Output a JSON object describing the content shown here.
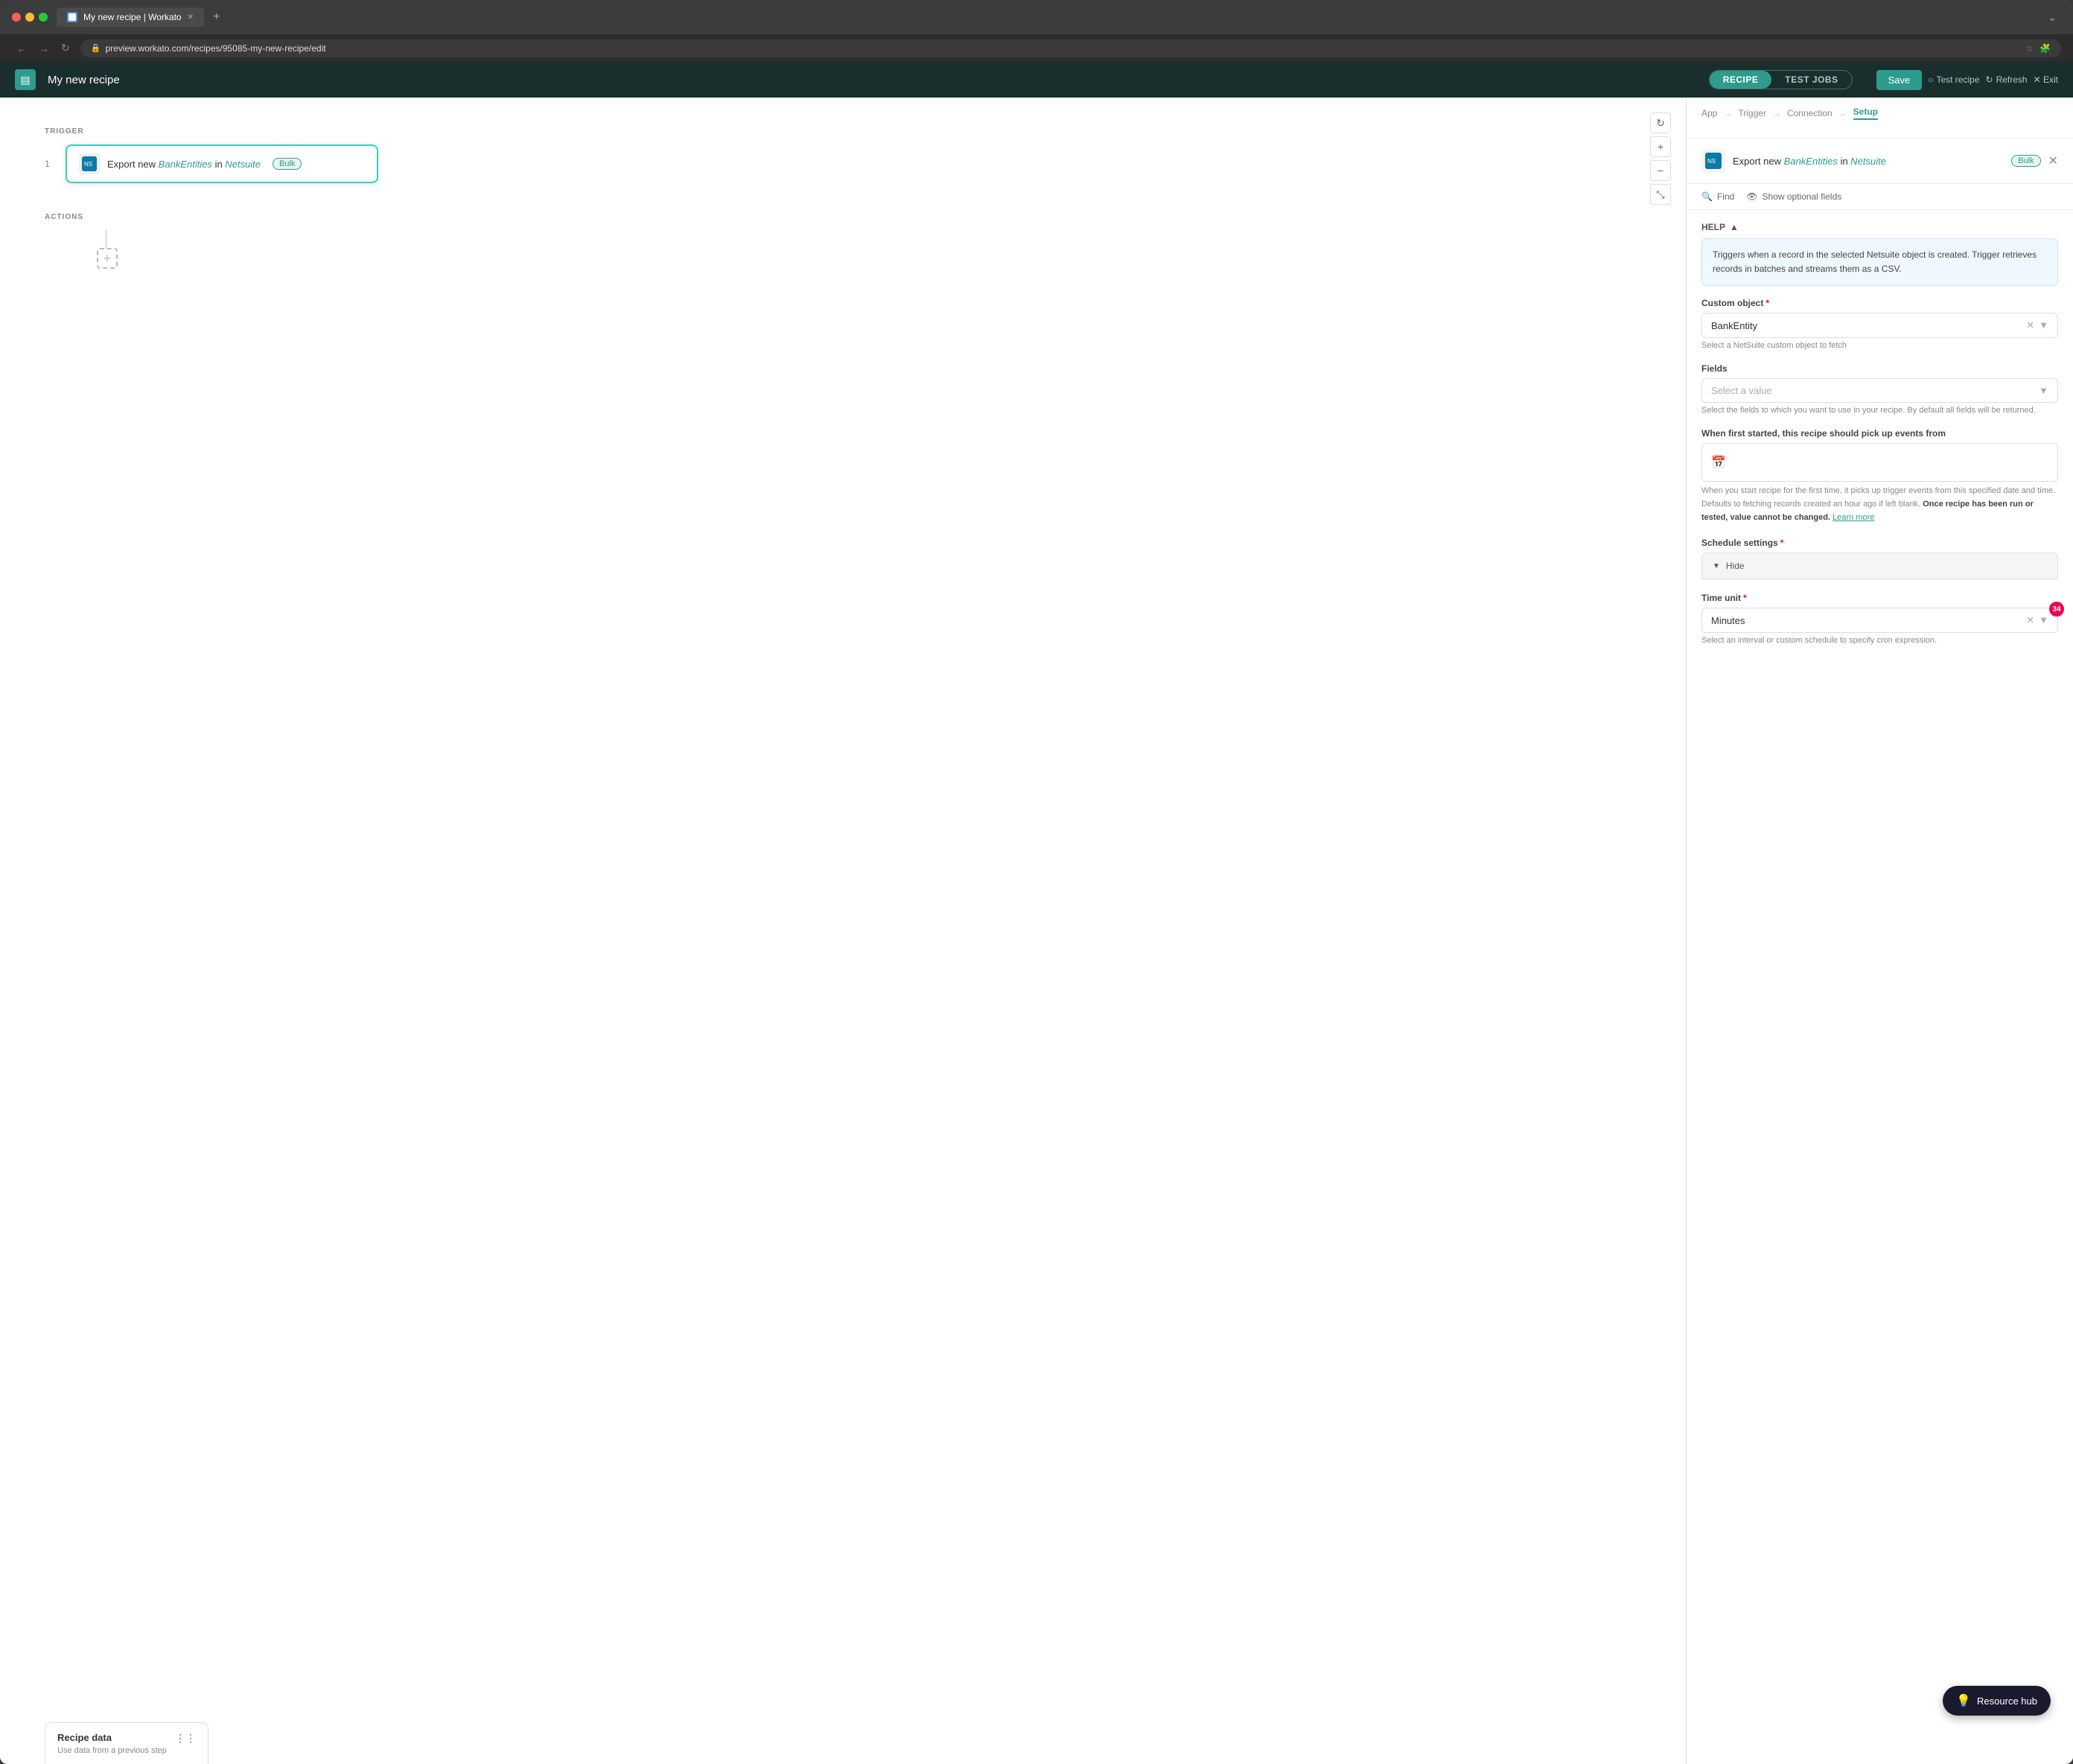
{
  "browser": {
    "tab_title": "My new recipe | Workato",
    "url": "preview.workato.com/recipes/95085-my-new-recipe/edit",
    "new_tab_icon": "+"
  },
  "header": {
    "logo_icon": "▤",
    "recipe_name": "My new recipe",
    "tabs": [
      {
        "id": "recipe",
        "label": "RECIPE",
        "active": true
      },
      {
        "id": "test-jobs",
        "label": "TEST JOBS",
        "active": false
      }
    ],
    "save_label": "Save",
    "test_recipe_label": "Test recipe",
    "refresh_label": "Refresh",
    "exit_label": "Exit"
  },
  "canvas": {
    "trigger_label": "TRIGGER",
    "actions_label": "ACTIONS",
    "step_number": "1",
    "trigger_card": {
      "text_before": "Export new",
      "entity": "BankEntities",
      "connector": "in",
      "app": "Netsuite",
      "badge": "Bulk"
    }
  },
  "recipe_data_panel": {
    "title": "Recipe data",
    "subtitle": "Use data from a previous step"
  },
  "right_panel": {
    "breadcrumb": {
      "items": [
        "App",
        "Trigger",
        "Connection",
        "Setup"
      ],
      "active": "Setup"
    },
    "trigger_header": {
      "prefix": "Export new",
      "entity": "BankEntities",
      "connector": "in",
      "app": "Netsuite",
      "badge": "Bulk"
    },
    "search_label": "Find",
    "optional_fields_label": "Show optional fields",
    "help": {
      "title": "HELP",
      "text": "Triggers when a record in the selected Netsuite object is created. Trigger retrieves records in batches and streams them as a CSV."
    },
    "custom_object": {
      "label": "Custom object",
      "required": true,
      "value": "BankEntity",
      "hint": "Select a NetSuite custom object to fetch"
    },
    "fields": {
      "label": "Fields",
      "placeholder": "Select a value",
      "hint": "Select the fields to which you want to use in your recipe. By default all fields will be returned."
    },
    "when_first_started": {
      "label": "When first started, this recipe should pick up events from",
      "hint_normal": "When you start recipe for the first time, it picks up trigger events from this specified date and time. Defaults to fetching records created an hour ago if left blank.",
      "hint_bold": "Once recipe has been run or tested, value cannot be changed.",
      "learn_more": "Learn more"
    },
    "schedule_settings": {
      "label": "Schedule settings",
      "required": true,
      "toggle_label": "Hide"
    },
    "time_unit": {
      "label": "Time unit",
      "required": true,
      "value": "Minutes",
      "badge": "34",
      "hint": "Select an interval or custom schedule to specify cron expression."
    }
  },
  "resource_hub": {
    "label": "Resource hub",
    "icon": "💡"
  }
}
